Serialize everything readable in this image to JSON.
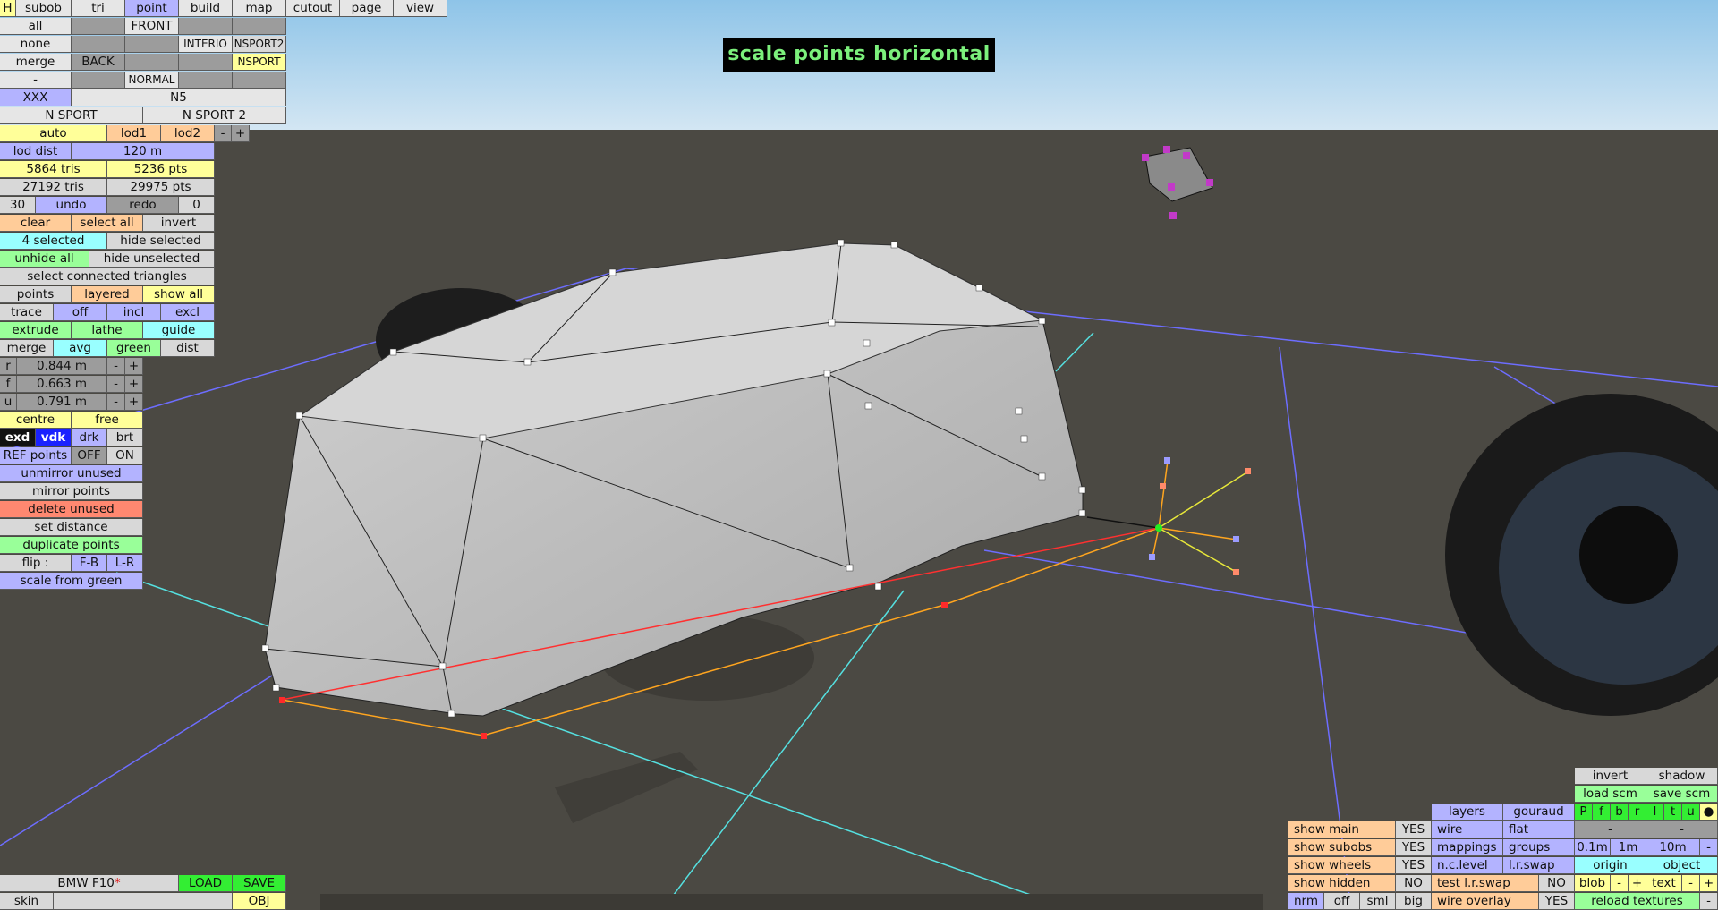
{
  "viewport": {
    "mode": "scale points horizontal"
  },
  "top_tabs": [
    "H",
    "subob",
    "tri",
    "point",
    "build",
    "map",
    "cutout",
    "page",
    "view"
  ],
  "view_grid": [
    [
      "all",
      "",
      "FRONT",
      "",
      ""
    ],
    [
      "none",
      "",
      "",
      "INTERIO",
      "NSPORT2"
    ],
    [
      "merge",
      "BACK",
      "",
      "",
      "NSPORT"
    ],
    [
      "-",
      "",
      "NORMAL",
      "",
      ""
    ]
  ],
  "lod_names": {
    "a": "XXX",
    "b": "N5",
    "c": "N SPORT",
    "d": "N SPORT 2"
  },
  "lod": {
    "auto": "auto",
    "lod1": "lod1",
    "lod2": "lod2",
    "minus": "-",
    "plus": "+",
    "dist_label": "lod dist",
    "dist_value": "120 m"
  },
  "stats": {
    "tris1": "5864 tris",
    "pts1": "5236 pts",
    "tris2": "27192 tris",
    "pts2": "29975 pts"
  },
  "history": {
    "count": "30",
    "undo": "undo",
    "redo": "redo",
    "redo_count": "0"
  },
  "select": {
    "clear": "clear",
    "all": "select all",
    "invert": "invert",
    "selected": "4 selected",
    "hide_selected": "hide selected",
    "unhide_all": "unhide all",
    "hide_unselected": "hide unselected",
    "connected": "select connected triangles",
    "points": "points",
    "layered": "layered",
    "show_all": "show all",
    "trace": "trace",
    "off": "off",
    "incl": "incl",
    "excl": "excl"
  },
  "ops": {
    "extrude": "extrude",
    "lathe": "lathe",
    "guide": "guide",
    "merge": "merge",
    "avg": "avg",
    "green": "green",
    "dist": "dist"
  },
  "coords": [
    {
      "axis": "r",
      "value": "0.844 m"
    },
    {
      "axis": "f",
      "value": "0.663 m"
    },
    {
      "axis": "u",
      "value": "0.791 m"
    }
  ],
  "pivot": {
    "centre": "centre",
    "free": "free"
  },
  "shade": {
    "exd": "exd",
    "vdk": "vdk",
    "drk": "drk",
    "brt": "brt"
  },
  "ref": {
    "label": "REF points",
    "off": "OFF",
    "on": "ON"
  },
  "actions": {
    "unmirror": "unmirror unused",
    "mirror": "mirror points",
    "delete": "delete unused",
    "set_distance": "set distance",
    "duplicate": "duplicate points",
    "flip": "flip :",
    "fb": "F-B",
    "lr": "L-R",
    "scale_green": "scale from green"
  },
  "file": {
    "name": "BMW F10",
    "modified_marker": "*",
    "load": "LOAD",
    "save": "SAVE",
    "skin": "skin",
    "obj": "OBJ"
  },
  "display": {
    "show_main": "show main",
    "show_subobs": "show subobs",
    "show_wheels": "show wheels",
    "show_hidden": "show hidden",
    "yes": "YES",
    "no": "NO",
    "nrm": "nrm",
    "off": "off",
    "sml": "sml",
    "big": "big",
    "layers": "layers",
    "gouraud": "gouraud",
    "wire": "wire",
    "flat": "flat",
    "mappings": "mappings",
    "groups": "groups",
    "nclevel": "n.c.level",
    "lrswap": "l.r.swap",
    "test_lrswap": "test l.r.swap",
    "wire_overlay": "wire overlay",
    "invert": "invert",
    "shadow": "shadow",
    "load_scm": "load scm",
    "save_scm": "save scm",
    "pfbrltu": [
      "P",
      "f",
      "b",
      "r",
      "l",
      "t",
      "u"
    ],
    "dash": "-",
    "grid_01": "0.1m",
    "grid_1": "1m",
    "grid_10": "10m",
    "origin": "origin",
    "object": "object",
    "blob": "blob",
    "minus": "-",
    "plus": "+",
    "text": "text",
    "reload": "reload textures"
  },
  "colors": {
    "title_text": "#7cf07c",
    "sky_top": "#8cc3e6",
    "ground": "#4b4943",
    "body": "#c4c4c4",
    "guide_blue": "#6d6dff",
    "guide_cyan": "#55e0e0"
  }
}
